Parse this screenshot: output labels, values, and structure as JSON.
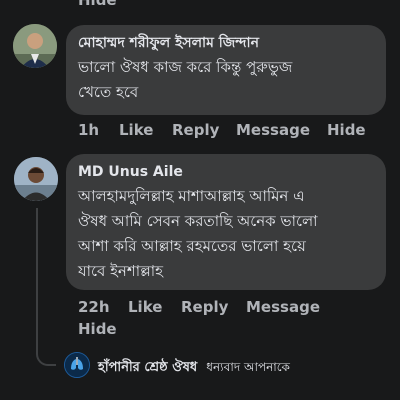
{
  "top": {
    "hide_label": "Hide"
  },
  "comments": [
    {
      "author": "মোহাম্মদ শরীফুল ইসলাম জিন্দান",
      "text_lines": [
        "ভালো ঔষধ কাজ করে কিন্তু পুরুভুজ",
        "খেতে হবে"
      ],
      "time": "1h",
      "actions": {
        "like": "Like",
        "reply": "Reply",
        "message": "Message",
        "hide": "Hide"
      }
    },
    {
      "author": "MD Unus Aile",
      "text_lines": [
        "আলহামদুলিল্লাহ মাশাআল্লাহ আমিন এ",
        "ঔষধ আমি সেবন করতাছি অনেক ভালো",
        "আশা করি আল্লাহ রহমতের ভালো হয়ে",
        "যাবে ইনশাল্লাহ"
      ],
      "time": "22h",
      "actions": {
        "like": "Like",
        "reply": "Reply",
        "message": "Message",
        "hide": "Hide"
      }
    }
  ],
  "reply": {
    "author": "হাঁপানীর শ্রেষ্ঠ ঔষধ",
    "text": "ধন্যবাদ আপনাকে"
  }
}
